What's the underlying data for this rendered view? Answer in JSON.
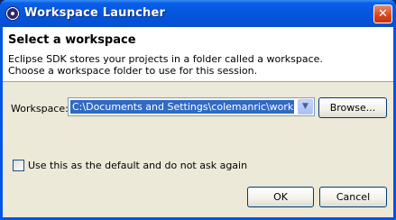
{
  "window": {
    "title": "Workspace Launcher",
    "close_glyph": "✕",
    "accent_color": "#0055e5"
  },
  "header": {
    "title": "Select a workspace",
    "description_line1": "Eclipse SDK stores your projects in a folder called a workspace.",
    "description_line2": "Choose a workspace folder to use for this session."
  },
  "workspace": {
    "label": "Workspace:",
    "value": "C:\\Documents and Settings\\colemanric\\workspace",
    "dropdown_glyph": "▼",
    "browse_label": "Browse..."
  },
  "default_option": {
    "label": "Use this as the default and do not ask again",
    "checked": false
  },
  "buttons": {
    "ok": "OK",
    "cancel": "Cancel"
  },
  "icons": {
    "app": "eclipse-icon",
    "close": "close-icon",
    "dropdown": "chevron-down-icon"
  }
}
